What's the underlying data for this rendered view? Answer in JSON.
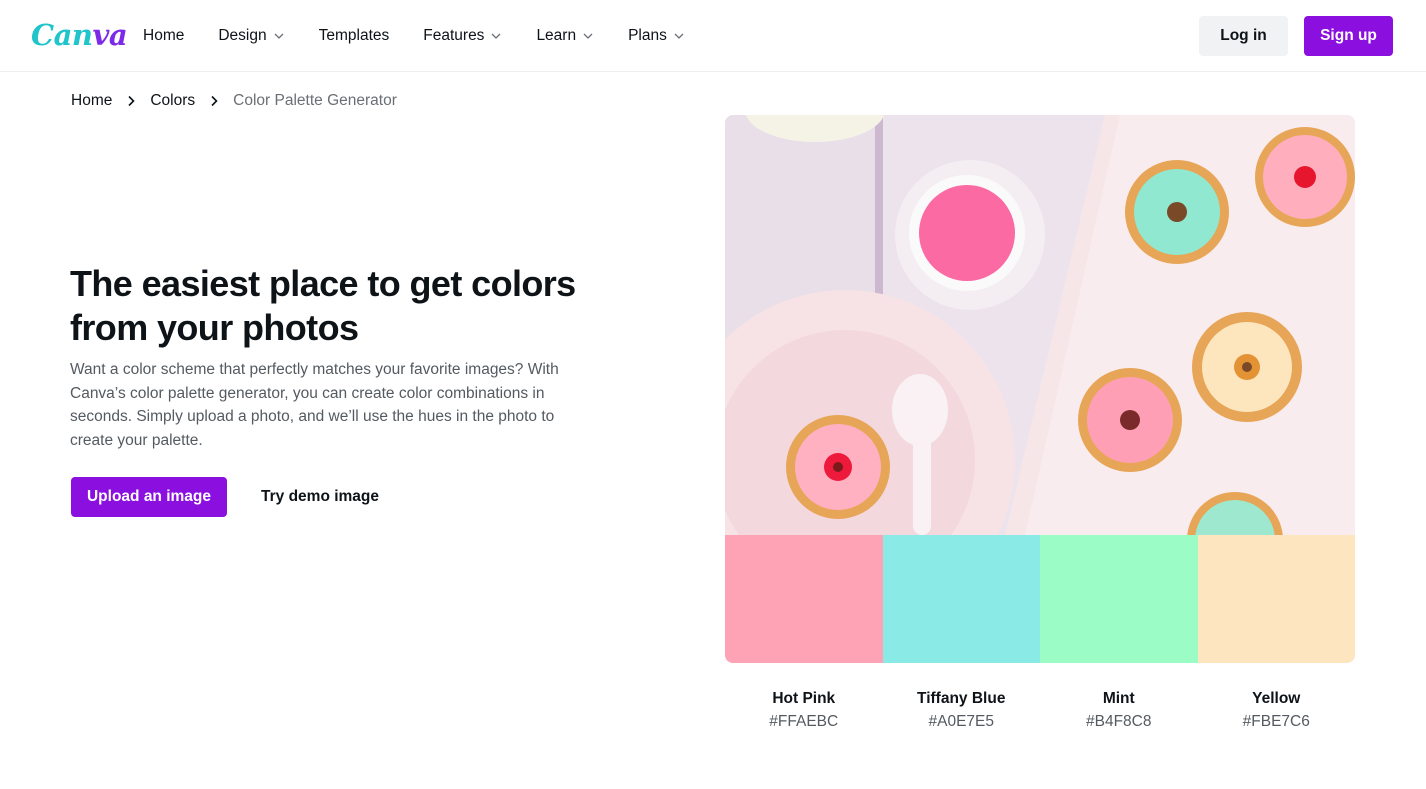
{
  "header": {
    "logo_part1": "Can",
    "logo_part2": "va",
    "nav": [
      {
        "label": "Home",
        "has_menu": false
      },
      {
        "label": "Design",
        "has_menu": true
      },
      {
        "label": "Templates",
        "has_menu": false
      },
      {
        "label": "Features",
        "has_menu": true
      },
      {
        "label": "Learn",
        "has_menu": true
      },
      {
        "label": "Plans",
        "has_menu": true
      }
    ],
    "login_label": "Log in",
    "signup_label": "Sign up"
  },
  "breadcrumb": {
    "items": [
      "Home",
      "Colors",
      "Color Palette Generator"
    ]
  },
  "hero": {
    "headline": "The easiest place to get colors from your photos",
    "description": "Want a color scheme that perfectly matches your favorite images? With Canva’s color palette generator, you can create color combinations in seconds. Simply upload a photo, and we’ll use the hues in the photo to create your palette.",
    "upload_label": "Upload an image",
    "demo_label": "Try demo image"
  },
  "palette": {
    "image_icon": "photo-of-iced-donuts",
    "colors": [
      {
        "name": "Hot Pink",
        "hex": "#FFAEBC",
        "display": "#fea3b5"
      },
      {
        "name": "Tiffany Blue",
        "hex": "#A0E7E5",
        "display": "#8aebe6"
      },
      {
        "name": "Mint",
        "hex": "#B4F8C8",
        "display": "#9cfcc6"
      },
      {
        "name": "Yellow",
        "hex": "#FBE7C6",
        "display": "#fde5c0"
      }
    ]
  },
  "colors": {
    "brand_purple": "#8b10e0",
    "logo_teal": "#20c4cb",
    "logo_purple": "#7d2ae8"
  }
}
